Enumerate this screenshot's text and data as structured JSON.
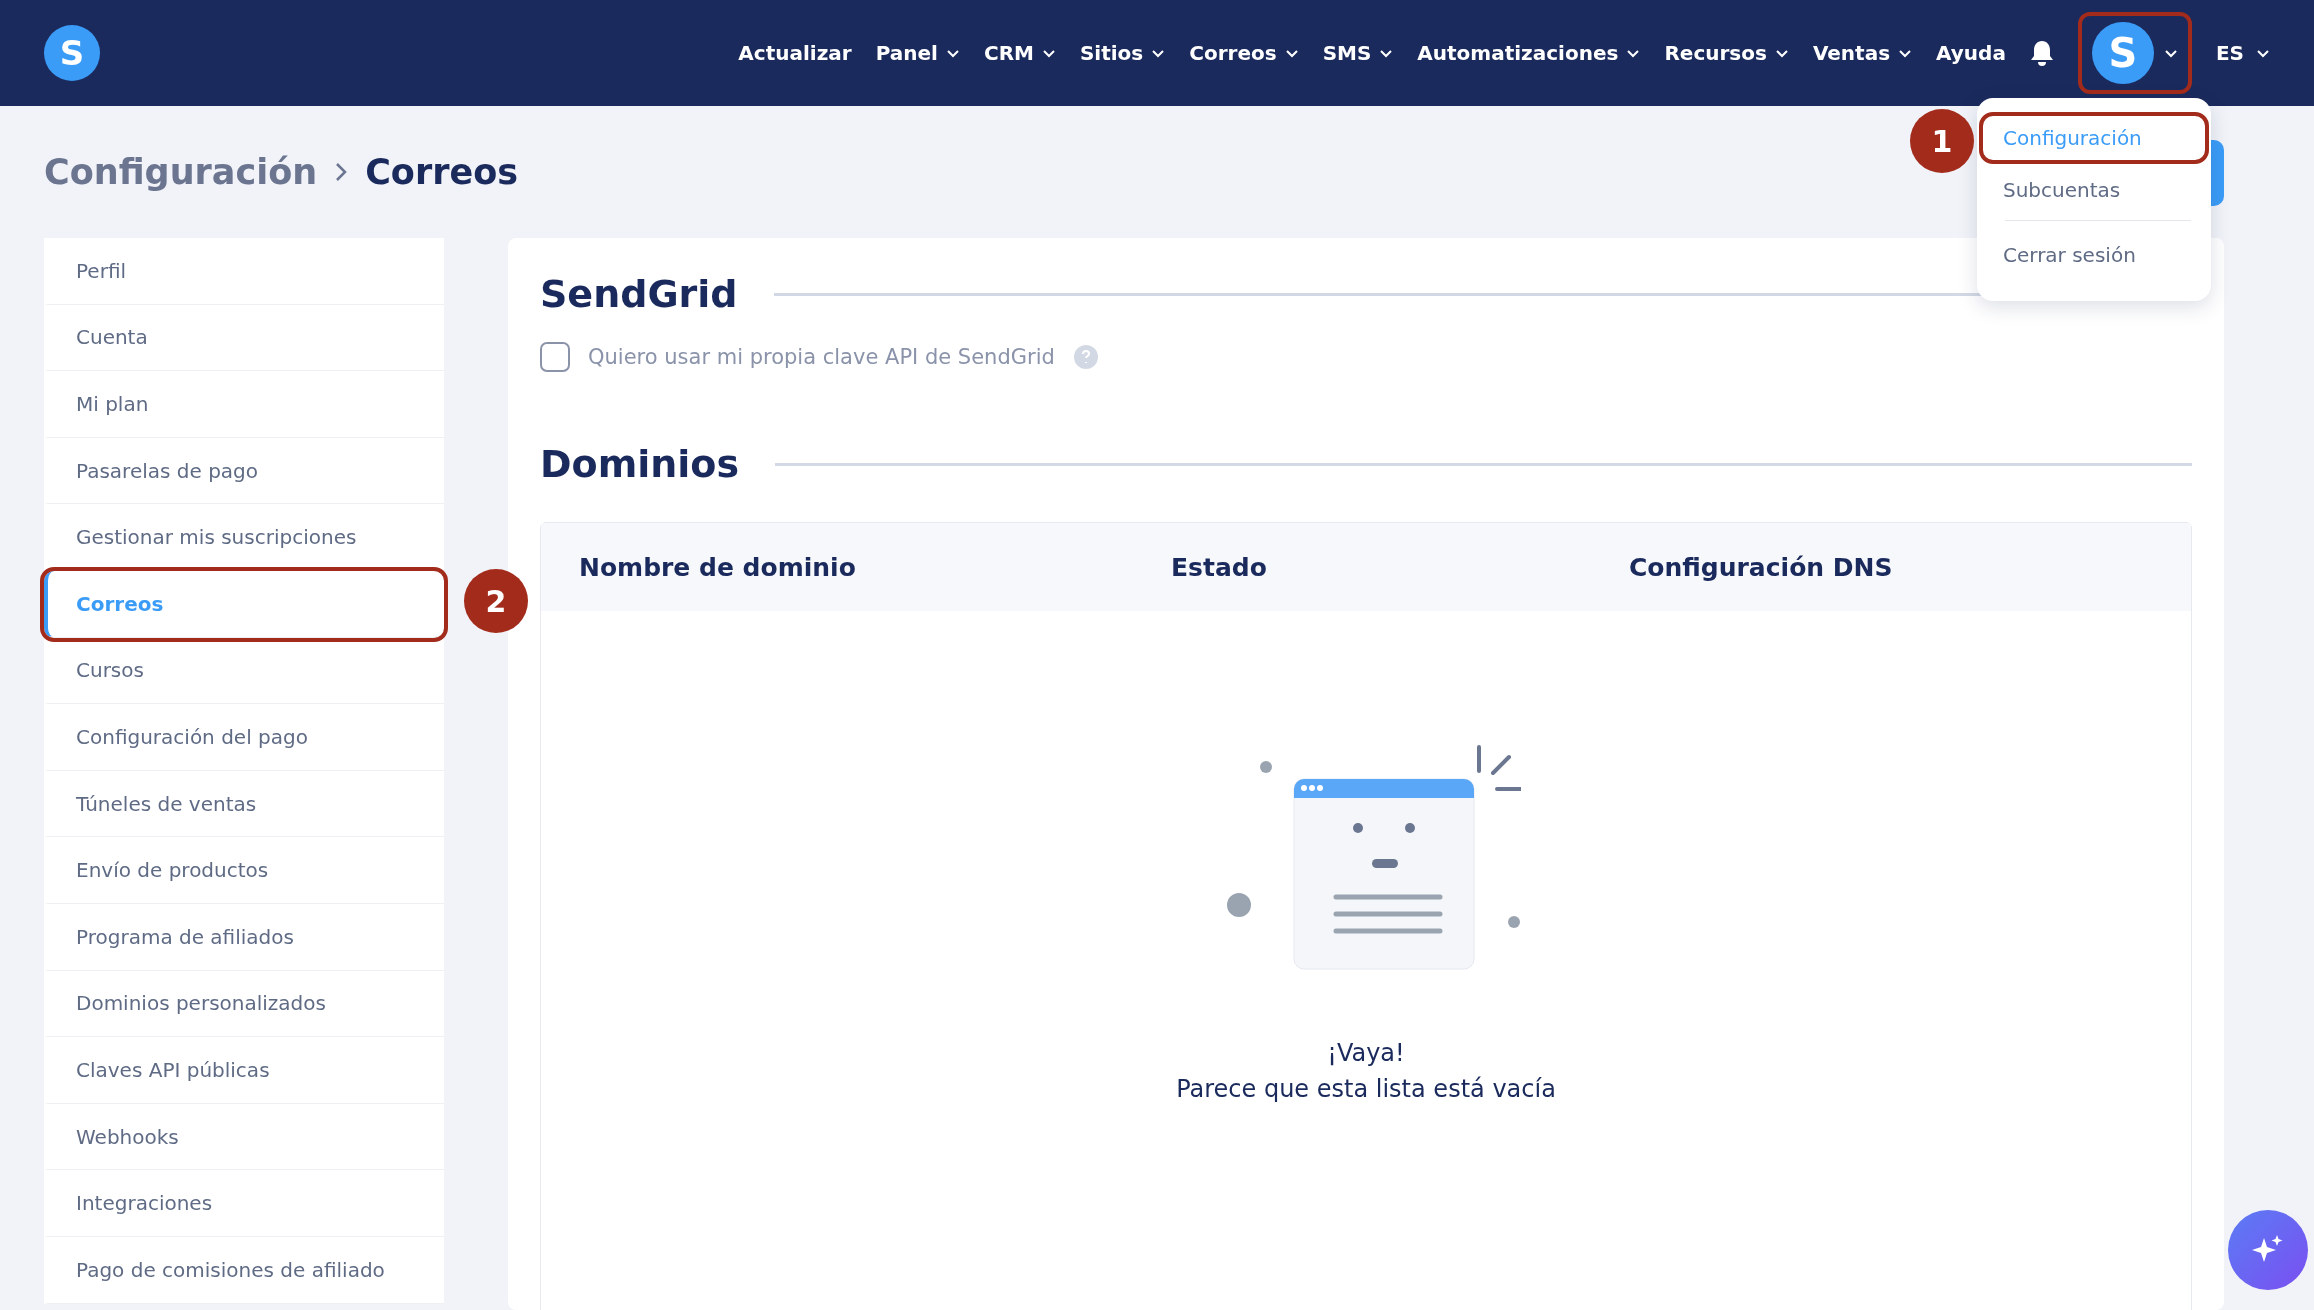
{
  "nav": {
    "logo_letter": "S",
    "items": [
      {
        "label": "Actualizar",
        "dropdown": false
      },
      {
        "label": "Panel",
        "dropdown": true
      },
      {
        "label": "CRM",
        "dropdown": true
      },
      {
        "label": "Sitios",
        "dropdown": true
      },
      {
        "label": "Correos",
        "dropdown": true
      },
      {
        "label": "SMS",
        "dropdown": true
      },
      {
        "label": "Automatizaciones",
        "dropdown": true
      },
      {
        "label": "Recursos",
        "dropdown": true
      },
      {
        "label": "Ventas",
        "dropdown": true
      },
      {
        "label": "Ayuda",
        "dropdown": false
      }
    ],
    "avatar_letter": "S",
    "avatar_highlighted": true,
    "language": "ES"
  },
  "user_menu": {
    "items": [
      {
        "label": "Configuración",
        "selected": true,
        "highlighted": true
      },
      {
        "label": "Subcuentas",
        "selected": false,
        "highlighted": false
      },
      {
        "label": "Cerrar sesión",
        "selected": false,
        "highlighted": false
      }
    ]
  },
  "step_markers": [
    "1",
    "2"
  ],
  "breadcrumb": [
    "Configuración",
    "Correos"
  ],
  "sidebar": {
    "items": [
      {
        "label": "Perfil",
        "selected": false,
        "highlighted": false
      },
      {
        "label": "Cuenta",
        "selected": false,
        "highlighted": false
      },
      {
        "label": "Mi plan",
        "selected": false,
        "highlighted": false
      },
      {
        "label": "Pasarelas de pago",
        "selected": false,
        "highlighted": false
      },
      {
        "label": "Gestionar mis suscripciones",
        "selected": false,
        "highlighted": false
      },
      {
        "label": "Correos",
        "selected": true,
        "highlighted": true
      },
      {
        "label": "Cursos",
        "selected": false,
        "highlighted": false
      },
      {
        "label": "Configuración del pago",
        "selected": false,
        "highlighted": false
      },
      {
        "label": "Túneles de ventas",
        "selected": false,
        "highlighted": false
      },
      {
        "label": "Envío de productos",
        "selected": false,
        "highlighted": false
      },
      {
        "label": "Programa de afiliados",
        "selected": false,
        "highlighted": false
      },
      {
        "label": "Dominios personalizados",
        "selected": false,
        "highlighted": false
      },
      {
        "label": "Claves API públicas",
        "selected": false,
        "highlighted": false
      },
      {
        "label": "Webhooks",
        "selected": false,
        "highlighted": false
      },
      {
        "label": "Integraciones",
        "selected": false,
        "highlighted": false
      },
      {
        "label": "Pago de comisiones de afiliado",
        "selected": false,
        "highlighted": false
      }
    ]
  },
  "sendgrid": {
    "title": "SendGrid",
    "checkbox": {
      "label": "Quiero usar mi propia clave API de SendGrid",
      "checked": false
    }
  },
  "domains": {
    "title": "Dominios",
    "table": {
      "columns": [
        "Nombre de dominio",
        "Estado",
        "Configuración DNS"
      ]
    },
    "empty_state": {
      "title": "¡Vaya!",
      "message": "Parece que esta lista está vacía"
    }
  }
}
